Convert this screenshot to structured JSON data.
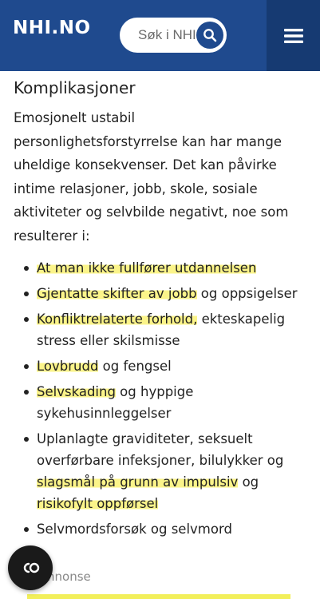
{
  "header": {
    "logo": "NHI.NO",
    "search_placeholder": "Søk i NHI",
    "search_icon": "search-icon",
    "menu_icon": "hamburger-menu-icon",
    "colors": {
      "header_bg": "#1f4a8e",
      "menu_bg": "#163a72",
      "highlight": "#fbf48a"
    }
  },
  "article": {
    "heading": "Komplikasjoner",
    "intro": "Emosjonelt ustabil personlighetsforstyrrelse kan har mange uheldige konsekvenser. Det kan påvirke intime relasjoner, jobb, skole, sosiale aktiviteter og selvbilde negativt, noe som resulterer i:",
    "items": [
      {
        "hl": "At man ikke fullfører utdannelsen",
        "rest": ""
      },
      {
        "hl": "Gjentatte skifter av jobb",
        "rest": " og oppsigelser"
      },
      {
        "hl": "Konfliktrelaterte forhold,",
        "rest": " ekteskapelig stress eller skilsmisse"
      },
      {
        "hl": "Lovbrudd",
        "rest": " og fengsel"
      },
      {
        "hl": "Selvskading",
        "rest": " og hyppige sykehusinnleggelser"
      },
      {
        "pre": "Uplanlagte graviditeter, seksuelt overførbare infeksjoner, bilulykker og ",
        "hl": "slagsmål på grunn av impulsiv",
        "mid": " og ",
        "hl2": "risikofylt oppførsel"
      },
      {
        "pre": "Selvmordsforsøk og selvmord"
      }
    ]
  },
  "ad_label": "nnonse",
  "fab_icon": "co-icon"
}
